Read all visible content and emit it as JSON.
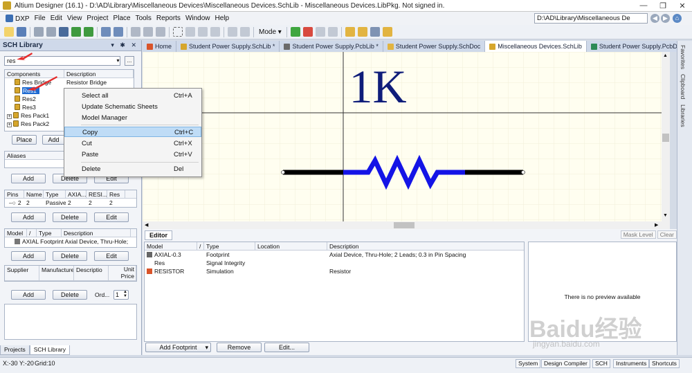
{
  "window": {
    "title": "Altium Designer (16.1) - D:\\AD\\Library\\Miscellaneous Devices\\Miscellaneous Devices.SchLib - Miscellaneous Devices.LibPkg. Not signed in.",
    "min": "—",
    "max": "❐",
    "close": "✕"
  },
  "menu": {
    "items": [
      "DXP",
      "File",
      "Edit",
      "View",
      "Project",
      "Place",
      "Tools",
      "Reports",
      "Window",
      "Help"
    ],
    "path": "D:\\AD\\Library\\Miscellaneous De"
  },
  "toolbar": {
    "mode_label": "Mode ▾"
  },
  "sch_library": {
    "title": "SCH Library",
    "pin_controls": "▾ ✱ ✕",
    "search_value": "res",
    "more_button": "...",
    "components_header": "Components",
    "description_header": "Description",
    "components": [
      {
        "name": "Res Bridge",
        "description": "Resistor Bridge",
        "expand": ""
      },
      {
        "name": "Res1",
        "description": "",
        "expand": ""
      },
      {
        "name": "Res2",
        "description": "",
        "expand": ""
      },
      {
        "name": "Res3",
        "description": "",
        "expand": ""
      },
      {
        "name": "Res Pack1",
        "description": "",
        "expand": "+"
      },
      {
        "name": "Res Pack2",
        "description": "",
        "expand": "+"
      }
    ],
    "place_button": "Place",
    "add_button": "Add",
    "aliases_header": "Aliases",
    "alias_add": "Add",
    "alias_delete": "Delete",
    "alias_edit": "Edit",
    "pins_headers": [
      "Pins",
      "Name",
      "Type",
      "AXIA...",
      "RESI...",
      "Res"
    ],
    "pins_row": [
      "2",
      "2",
      "Passive",
      "2",
      "2",
      "2"
    ],
    "pin_add": "Add",
    "pin_delete": "Delete",
    "pin_edit": "Edit",
    "model_headers": [
      "Model",
      "/",
      "Type",
      "Description"
    ],
    "model_row": "AXIAL Footprint Axial Device, Thru-Hole;",
    "model_add": "Add",
    "model_delete": "Delete",
    "model_edit": "Edit",
    "supplier_headers": [
      "Supplier",
      "Manufacture",
      "Descriptio",
      "Unit Price"
    ],
    "sup_add": "Add",
    "sup_delete": "Delete",
    "order_label": "Ord...",
    "order_value": "1",
    "tab_projects": "Projects",
    "tab_schlib": "SCH Library"
  },
  "context_menu": {
    "items": [
      {
        "label": "Select all",
        "shortcut": "Ctrl+A"
      },
      {
        "label": "Update Schematic Sheets",
        "shortcut": ""
      },
      {
        "label": "Model Manager",
        "shortcut": ""
      },
      {
        "label": "Copy",
        "shortcut": "Ctrl+C"
      },
      {
        "label": "Cut",
        "shortcut": "Ctrl+X"
      },
      {
        "label": "Paste",
        "shortcut": "Ctrl+V"
      },
      {
        "label": "Delete",
        "shortcut": "Del"
      }
    ]
  },
  "doc_tabs": [
    {
      "label": "Home",
      "color": "#d9542a"
    },
    {
      "label": "Student Power Supply.SchLib *",
      "color": "#d6a62c"
    },
    {
      "label": "Student Power Supply.PcbLib *",
      "color": "#6a6a6a"
    },
    {
      "label": "Student Power Supply.SchDoc",
      "color": "#e2b441"
    },
    {
      "label": "Miscellaneous Devices.SchLib",
      "color": "#d6a62c"
    },
    {
      "label": "Student Power Supply.PcbDoc",
      "color": "#2e8b57"
    }
  ],
  "canvas": {
    "value_text": "1K",
    "resistor_color": "#1414e6",
    "lead_color": "#000000",
    "text_color": "#0f1d7a"
  },
  "right_tabs": [
    "Favorites",
    "Clipboard",
    "Libraries"
  ],
  "editor": {
    "tab": "Editor",
    "mask_level": "Mask Level",
    "clear": "Clear",
    "headers": [
      "Model",
      "/",
      "Type",
      "Location",
      "Description"
    ],
    "rows": [
      {
        "model": "AXIAL-0.3",
        "type": "Footprint",
        "location": "",
        "description": "Axial Device, Thru-Hole; 2 Leads; 0.3 in Pin Spacing"
      },
      {
        "model": "Res",
        "type": "Signal Integrity",
        "location": "",
        "description": ""
      },
      {
        "model": "RESISTOR",
        "type": "Simulation",
        "location": "",
        "description": "Resistor"
      }
    ],
    "no_preview": "There is no preview available",
    "add_footprint": "Add Footprint",
    "remove": "Remove",
    "edit": "Edit..."
  },
  "status": {
    "coords": "X:-30 Y:-20",
    "grid": "Grid:10",
    "buttons": [
      "System",
      "Design Compiler",
      "SCH",
      "Instruments",
      "Shortcuts"
    ]
  },
  "watermark": {
    "brand": "Baidu经验",
    "url": "jingyan.baidu.com"
  }
}
